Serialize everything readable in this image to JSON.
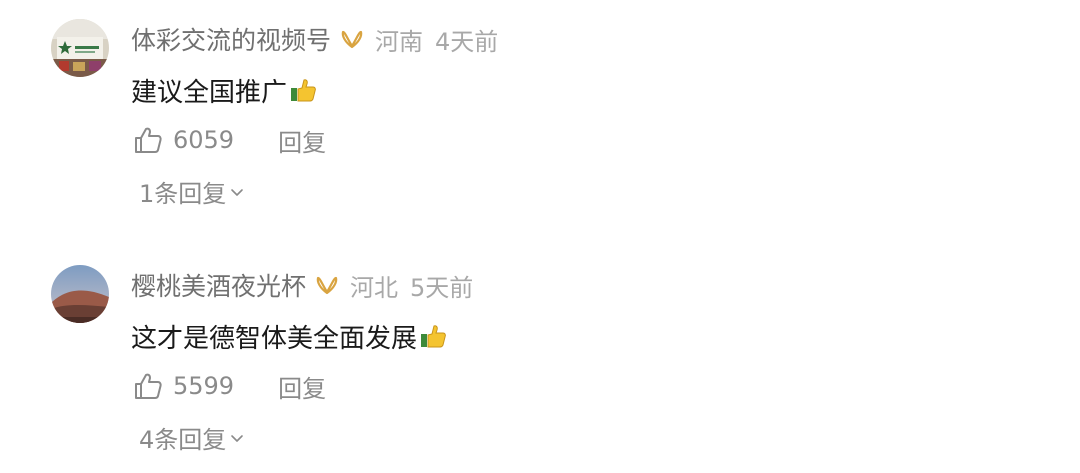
{
  "colors": {
    "username": "#707070",
    "meta": "#a8a8a8",
    "text": "#1a1a1a",
    "action": "#8a8a8a",
    "badge": "#d9a441"
  },
  "comments": [
    {
      "username": "体彩交流的视频号",
      "location": "河南",
      "time": "4天前",
      "text": "建议全国推广",
      "emoji": "thumbs-up",
      "likes": "6059",
      "reply_label": "回复",
      "replies_label": "1条回复"
    },
    {
      "username": "樱桃美酒夜光杯",
      "location": "河北",
      "time": "5天前",
      "text": "这才是德智体美全面发展",
      "emoji": "thumbs-up",
      "likes": "5599",
      "reply_label": "回复",
      "replies_label": "4条回复"
    }
  ]
}
